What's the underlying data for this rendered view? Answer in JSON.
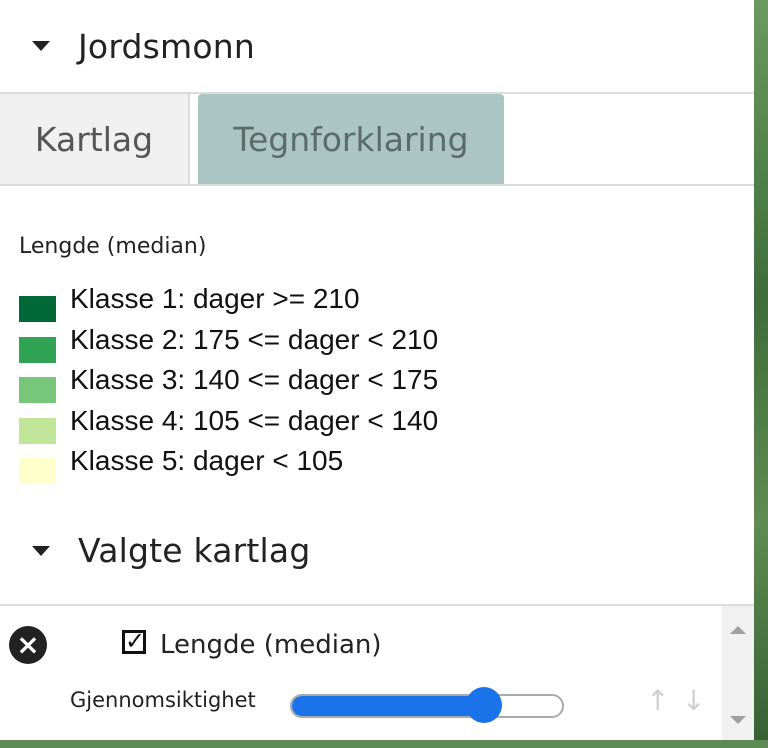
{
  "panel": {
    "section_title": "Jordsmonn",
    "tabs": [
      {
        "label": "Kartlag",
        "active": false
      },
      {
        "label": "Tegnforklaring",
        "active": true
      }
    ]
  },
  "legend": {
    "title": "Lengde (median)",
    "items": [
      {
        "label": "Klasse 1: dager >= 210",
        "color": "#006837"
      },
      {
        "label": "Klasse 2: 175 <= dager < 210",
        "color": "#31a354"
      },
      {
        "label": "Klasse 3: 140 <= dager < 175",
        "color": "#78c679"
      },
      {
        "label": "Klasse 4: 105 <= dager < 140",
        "color": "#c2e699"
      },
      {
        "label": "Klasse 5: dager < 105",
        "color": "#ffffcc"
      }
    ]
  },
  "selected_layers": {
    "section_title": "Valgte kartlag",
    "layer": {
      "name": "Lengde (median)",
      "checked": true,
      "opacity_label": "Gjennomsiktighet",
      "opacity_value": 0.71
    },
    "icons": {
      "remove": "close-circle-icon",
      "move_up": "arrow-up-icon",
      "move_down": "arrow-down-icon"
    }
  }
}
